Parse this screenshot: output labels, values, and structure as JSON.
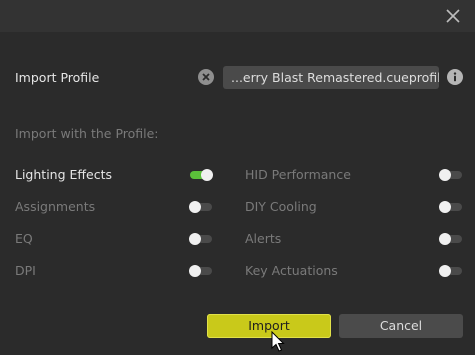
{
  "dialog": {
    "close_icon": "close-x-icon"
  },
  "import_profile": {
    "label": "Import Profile",
    "clear_icon": "clear-circle-x-icon",
    "file_value": "...erry Blast Remastered.cueprofile",
    "info_icon": "info-circle-icon"
  },
  "section": {
    "heading": "Import with the Profile:"
  },
  "options_left": [
    {
      "label": "Lighting Effects",
      "enabled": true
    },
    {
      "label": "Assignments",
      "enabled": false
    },
    {
      "label": "EQ",
      "enabled": false
    },
    {
      "label": "DPI",
      "enabled": false
    }
  ],
  "options_right": [
    {
      "label": "HID Performance",
      "enabled": false
    },
    {
      "label": "DIY Cooling",
      "enabled": false
    },
    {
      "label": "Alerts",
      "enabled": false
    },
    {
      "label": "Key Actuations",
      "enabled": false
    }
  ],
  "buttons": {
    "import_label": "Import",
    "cancel_label": "Cancel"
  },
  "colors": {
    "background": "#2b2b2b",
    "titlebar": "#333333",
    "accent_yellow": "#c9c91a",
    "toggle_on": "#5bbf3a",
    "toggle_off": "#4a4a4a"
  }
}
